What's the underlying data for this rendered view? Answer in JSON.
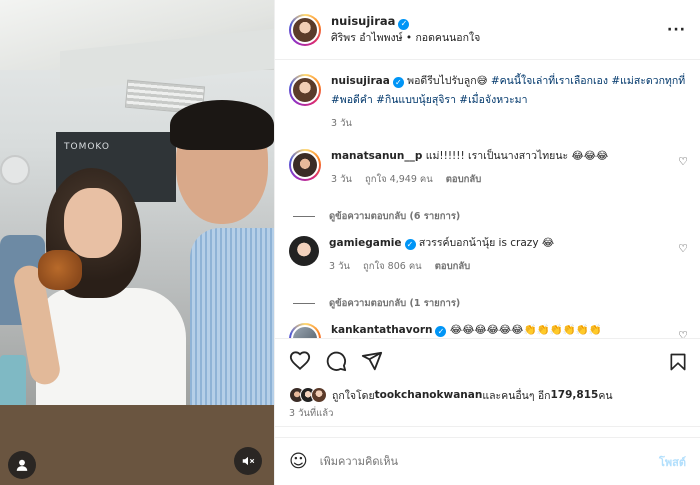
{
  "header": {
    "username": "nuisujiraa",
    "subtitle": "ศิริพร อำไพพงษ์ • กอดคนนอกใจ"
  },
  "caption": {
    "username": "nuisujiraa",
    "text_pre": "พอดีรีบไปรับลูก😅 ",
    "hashtags": "#คนนี้ใจเล่าที่เราเลือกเอง #แม่สะดวกทุกที่ #พอดีคำ #กินแบบนุ้ยสุจิรา #เมื่อจังหวะมา",
    "time": "3 วัน"
  },
  "comments": [
    {
      "username": "manatsanun__p",
      "text": "แม่!!!!!! เราเป็นนางสาวไทยนะ 😂😂😂",
      "time": "3 วัน",
      "likes": "ถูกใจ 4,949 คน",
      "reply": "ตอบกลับ",
      "view_replies": "ดูข้อความตอบกลับ (6 รายการ)"
    },
    {
      "username": "gamiegamie",
      "text": "สวรรค์บอกน้านุ้ย is crazy 😂",
      "time": "3 วัน",
      "likes": "ถูกใจ 806 คน",
      "reply": "ตอบกลับ",
      "view_replies": "ดูข้อความตอบกลับ (1 รายการ)"
    },
    {
      "username": "kankantathavorn",
      "text": "😂😂😂😂😂😂👏👏👏👏👏👏"
    }
  ],
  "likes_line": {
    "prefix": "ถูกใจโดย ",
    "user": "tookchanokwanan",
    "middle": " และคนอื่นๆ อีก ",
    "count": "179,815",
    "suffix": " คน"
  },
  "posted_ago": "3 วันที่แล้ว",
  "add_comment": {
    "placeholder": "เพิ่มความคิดเห็น",
    "post_label": "โพสต์"
  },
  "photo": {
    "sign_text": "TOMOKO"
  },
  "colors": {
    "verified": "#0095f6",
    "hashtag": "#00376b",
    "muted": "#737373",
    "post_disabled": "#b2dffc"
  },
  "icons": [
    "verified-badge-icon",
    "more-options-icon",
    "heart-icon",
    "comment-icon",
    "share-icon",
    "bookmark-icon",
    "emoji-icon",
    "user-tag-icon",
    "mute-icon"
  ]
}
